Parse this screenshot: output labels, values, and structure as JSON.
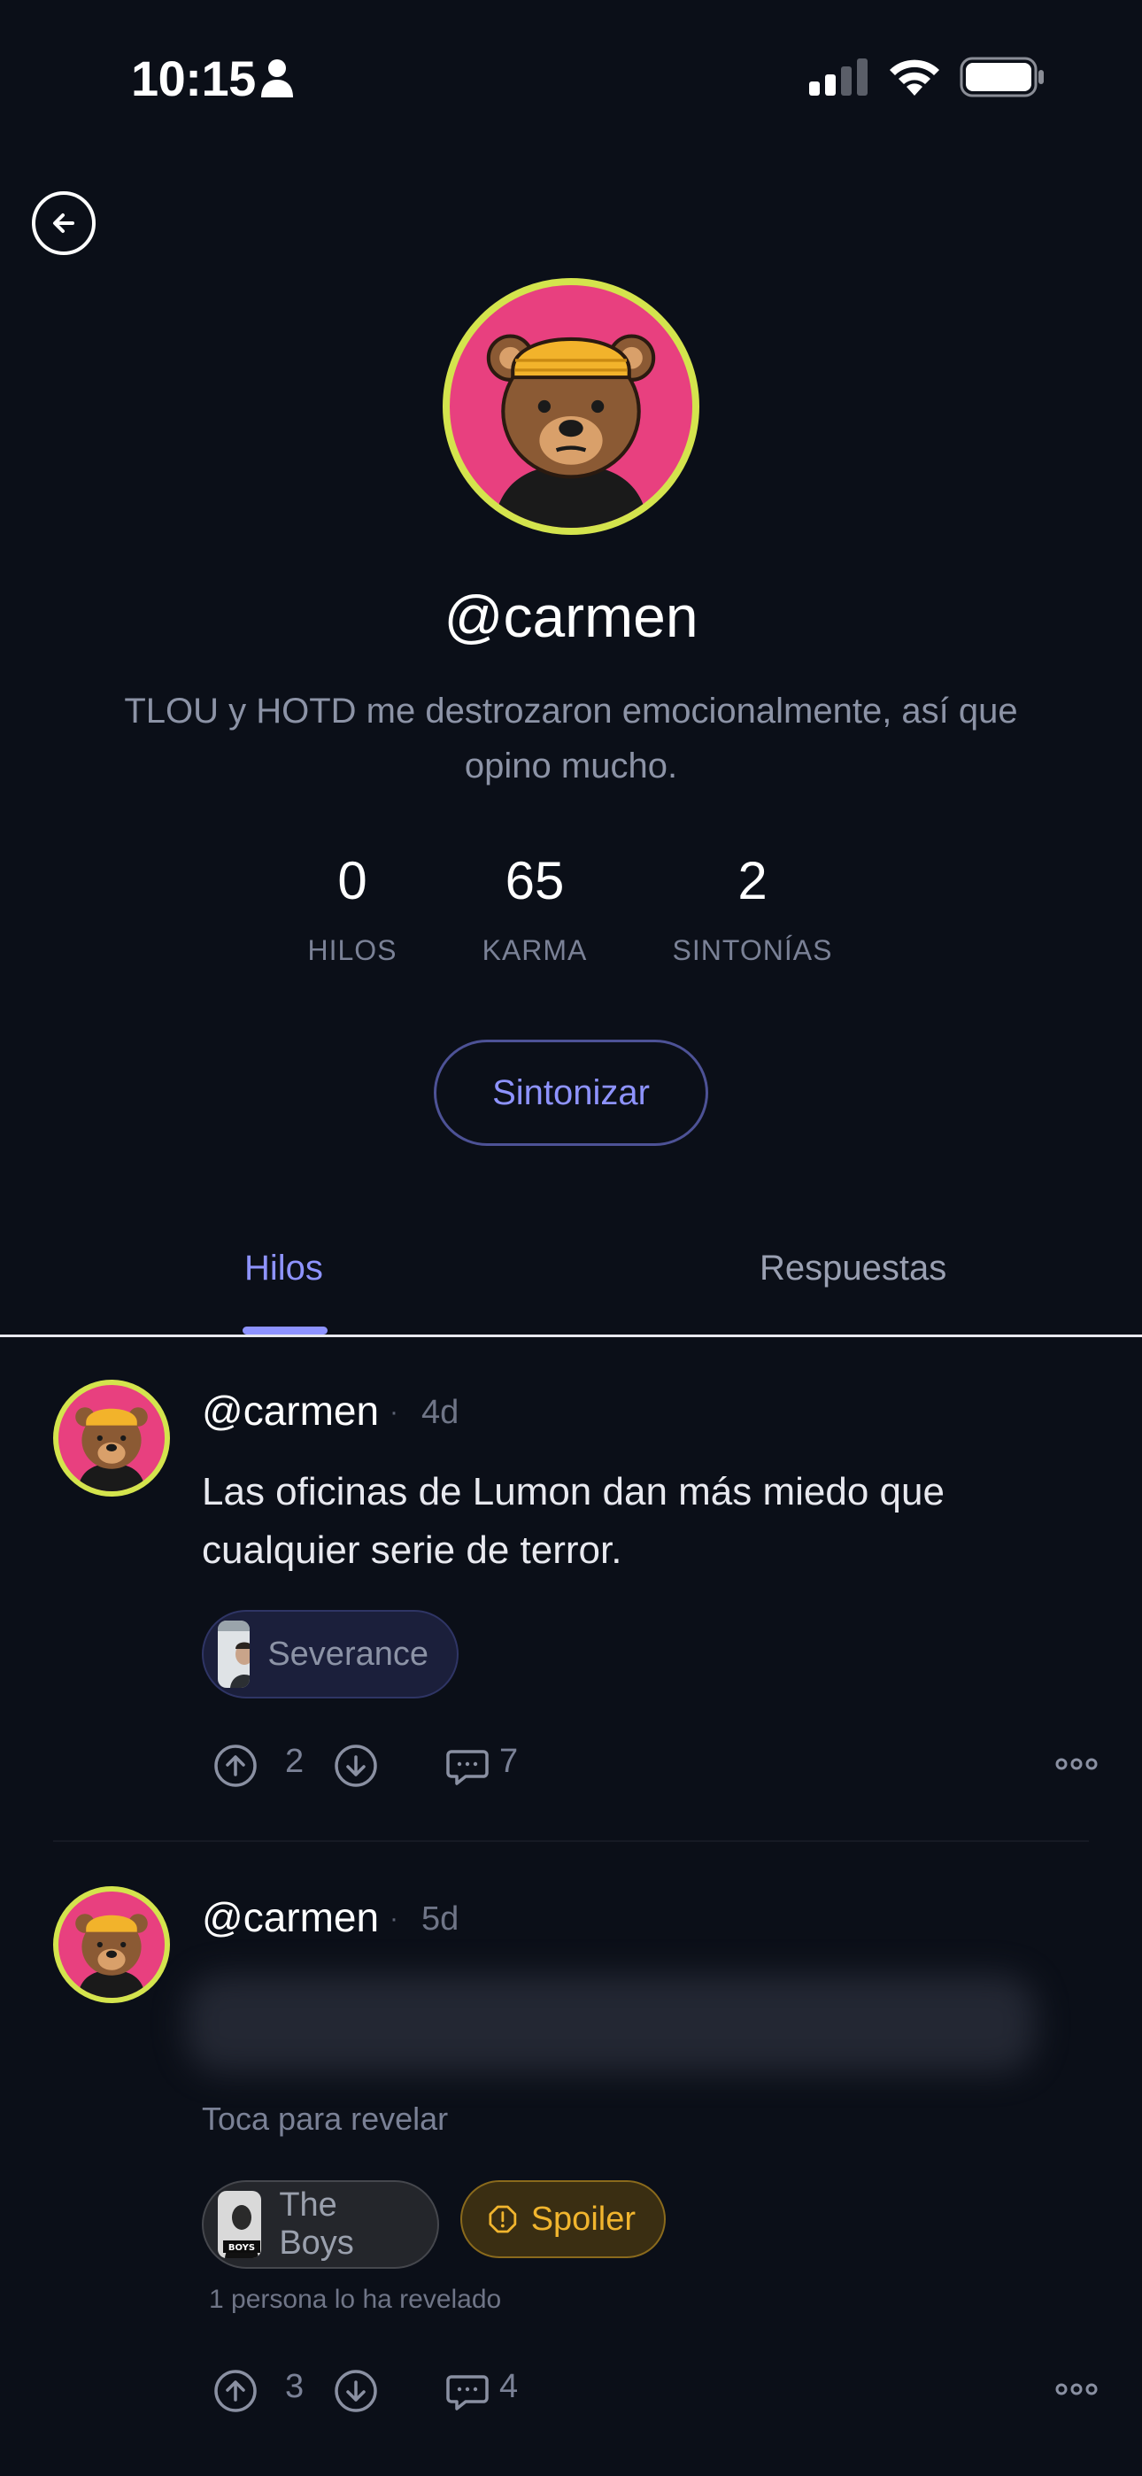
{
  "status_bar": {
    "time": "10:15"
  },
  "profile": {
    "username": "@carmen",
    "bio": "TLOU y HOTD me destrozaron emocionalmente, así que opino mucho.",
    "stats": [
      {
        "value": "0",
        "label": "HILOS"
      },
      {
        "value": "65",
        "label": "KARMA"
      },
      {
        "value": "2",
        "label": "SINTONÍAS"
      }
    ],
    "action_label": "Sintonizar"
  },
  "tabs": [
    {
      "label": "Hilos",
      "active": true
    },
    {
      "label": "Respuestas",
      "active": false
    }
  ],
  "posts": [
    {
      "user": "@carmen",
      "dot": "·",
      "time": "4d",
      "text": "Las oficinas de Lumon dan más miedo que cualquier serie de terror.",
      "show": "Severance",
      "upvotes": "2",
      "comments": "7"
    },
    {
      "user": "@carmen",
      "dot": "·",
      "time": "5d",
      "reveal_hint": "Toca para revelar",
      "show": "The Boys",
      "spoiler_label": "Spoiler",
      "revealed_count": "1 persona lo ha revelado",
      "upvotes": "3",
      "comments": "4"
    }
  ],
  "colors": {
    "accent": "#8e93ff",
    "avatar_ring": "#d4e44d",
    "avatar_bg": "#e8407f",
    "spoiler": "#f1b52e",
    "background": "#0b0f18"
  }
}
